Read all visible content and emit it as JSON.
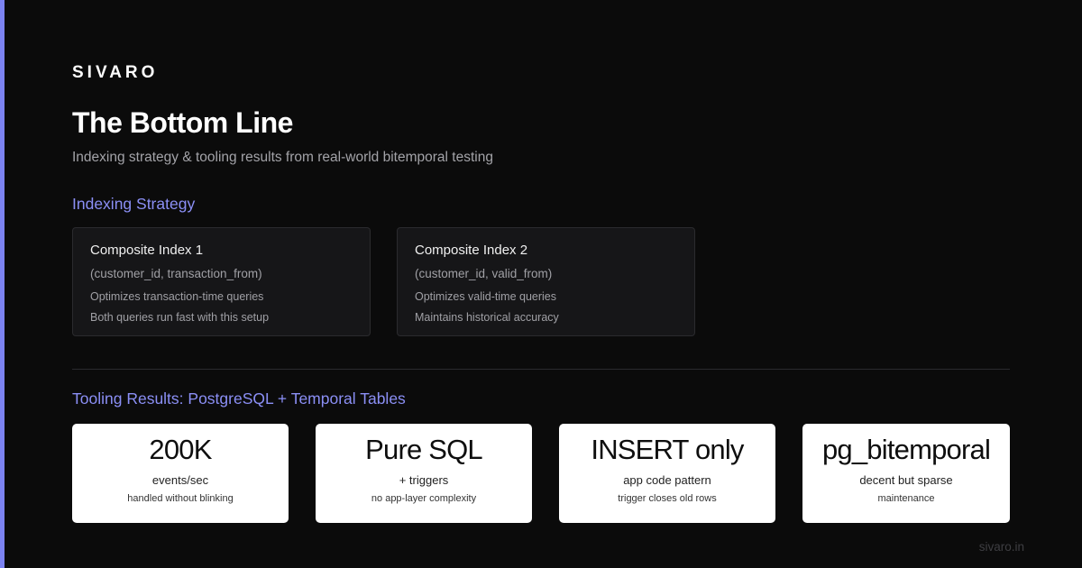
{
  "brand": "SIVARO",
  "title": "The Bottom Line",
  "subtitle": "Indexing strategy & tooling results from real-world bitemporal testing",
  "indexing": {
    "heading": "Indexing Strategy",
    "cards": [
      {
        "title": "Composite Index 1",
        "columns": "(customer_id, transaction_from)",
        "line1": "Optimizes transaction-time queries",
        "line2": "Both queries run fast with this setup"
      },
      {
        "title": "Composite Index 2",
        "columns": "(customer_id, valid_from)",
        "line1": "Optimizes valid-time queries",
        "line2": "Maintains historical accuracy"
      }
    ]
  },
  "tooling": {
    "heading": "Tooling Results: PostgreSQL + Temporal Tables",
    "stats": [
      {
        "value": "200K",
        "label": "events/sec",
        "note": "handled without blinking"
      },
      {
        "value": "Pure SQL",
        "label": "+ triggers",
        "note": "no app-layer complexity"
      },
      {
        "value": "INSERT only",
        "label": "app code pattern",
        "note": "trigger closes old rows"
      },
      {
        "value": "pg_bitemporal",
        "label": "decent but sparse",
        "note": "maintenance"
      }
    ]
  },
  "footer": "sivaro.in",
  "colors": {
    "background": "#0b0b0b",
    "accent": "#7c83f2",
    "section_heading": "#8b8ff5",
    "card": "#161618"
  }
}
